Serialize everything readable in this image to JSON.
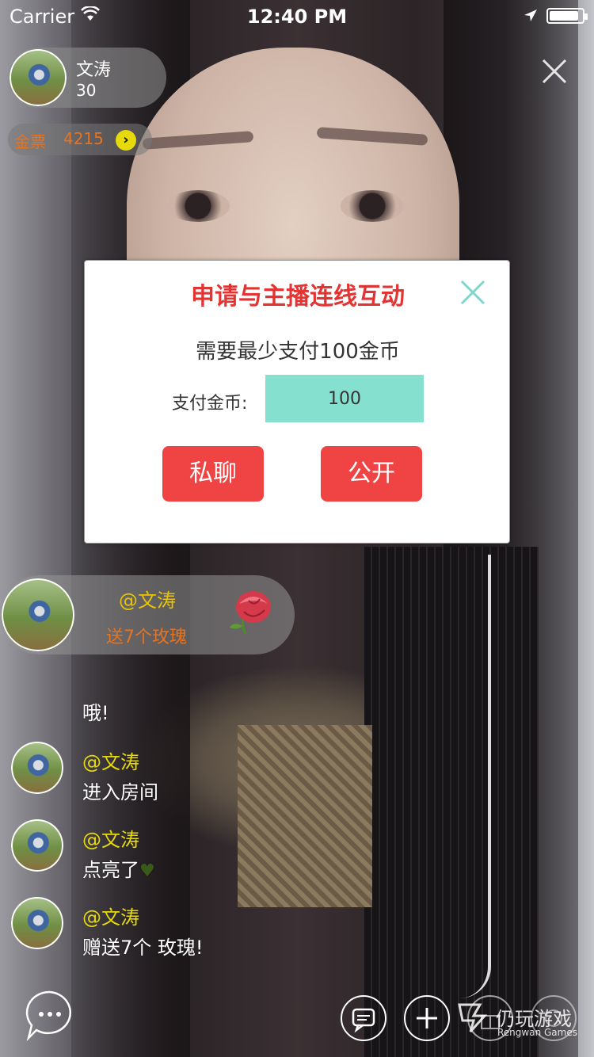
{
  "status_bar": {
    "carrier": "Carrier",
    "time": "12:40 PM",
    "battery_level": 0.9,
    "icons": [
      "wifi-icon",
      "location-arrow-icon",
      "battery-icon"
    ]
  },
  "host": {
    "name": "文涛",
    "viewer_count": "30"
  },
  "coins": {
    "label": "金票",
    "value": "4215",
    "arrow_icon": "chevron-right-icon"
  },
  "dialog": {
    "title": "申请与主播连线互动",
    "description": "需要最少支付100金币",
    "pay_label": "支付金币:",
    "pay_value": "100",
    "private_button": "私聊",
    "public_button": "公开",
    "close_icon": "close-icon",
    "accent_color": "#e33434",
    "button_color": "#f04444",
    "input_color": "#86e0d0"
  },
  "gift_banner": {
    "user": "@文涛",
    "message": "送7个玫瑰",
    "gift_icon": "rose-icon"
  },
  "chat": [
    {
      "text": "哦!"
    },
    {
      "user": "@文涛",
      "text": "进入房间"
    },
    {
      "user": "@文涛",
      "text": "点亮了",
      "icon": "heart-icon"
    },
    {
      "user": "@文涛",
      "text": "赠送7个 玫瑰!"
    }
  ],
  "bottom_bar": {
    "icons": [
      "chat-bubble-icon",
      "message-icon",
      "add-icon",
      "gift-icon",
      "share-icon"
    ]
  },
  "watermark": {
    "cn": "仍玩游戏",
    "en": "Rengwan Games"
  }
}
